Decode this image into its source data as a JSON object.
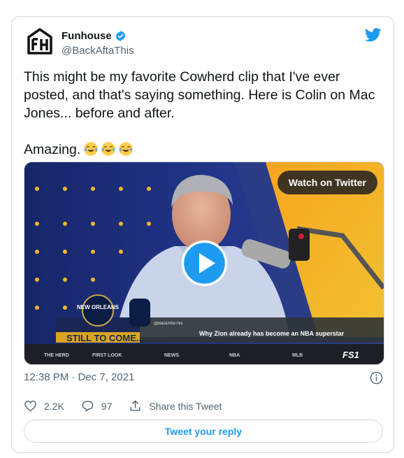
{
  "tweet": {
    "display_name": "Funhouse",
    "handle": "@BackAftaThis",
    "text_p1": "This might be my favorite Cowherd clip that I've ever posted, and that's saying something. Here is Colin on Mac Jones... before and after.",
    "text_p2": "Amazing.",
    "emojis": [
      "face-with-tears-of-joy",
      "face-with-tears-of-joy",
      "face-with-tears-of-joy"
    ],
    "timestamp": "12:38 PM · Dec 7, 2021"
  },
  "media": {
    "watch_label": "Watch on Twitter",
    "lower_third_left": "STILL TO COME...",
    "lower_third_right": "Why Zion already has become an NBA superstar",
    "logo_text": "NEW ORLEANS",
    "credit": "@BackAftaThis",
    "ticker_items": [
      "THE HERD",
      "FIRST LOOK",
      "NEWS",
      "NBA",
      "MLB"
    ],
    "network": "FS1"
  },
  "actions": {
    "likes": "2.2K",
    "replies": "97",
    "share_label": "Share this Tweet"
  },
  "reply_label": "Tweet your reply",
  "colors": {
    "accent": "#1d9bf0",
    "text": "#0f1419",
    "muted": "#536471",
    "border": "#cfd9de"
  }
}
